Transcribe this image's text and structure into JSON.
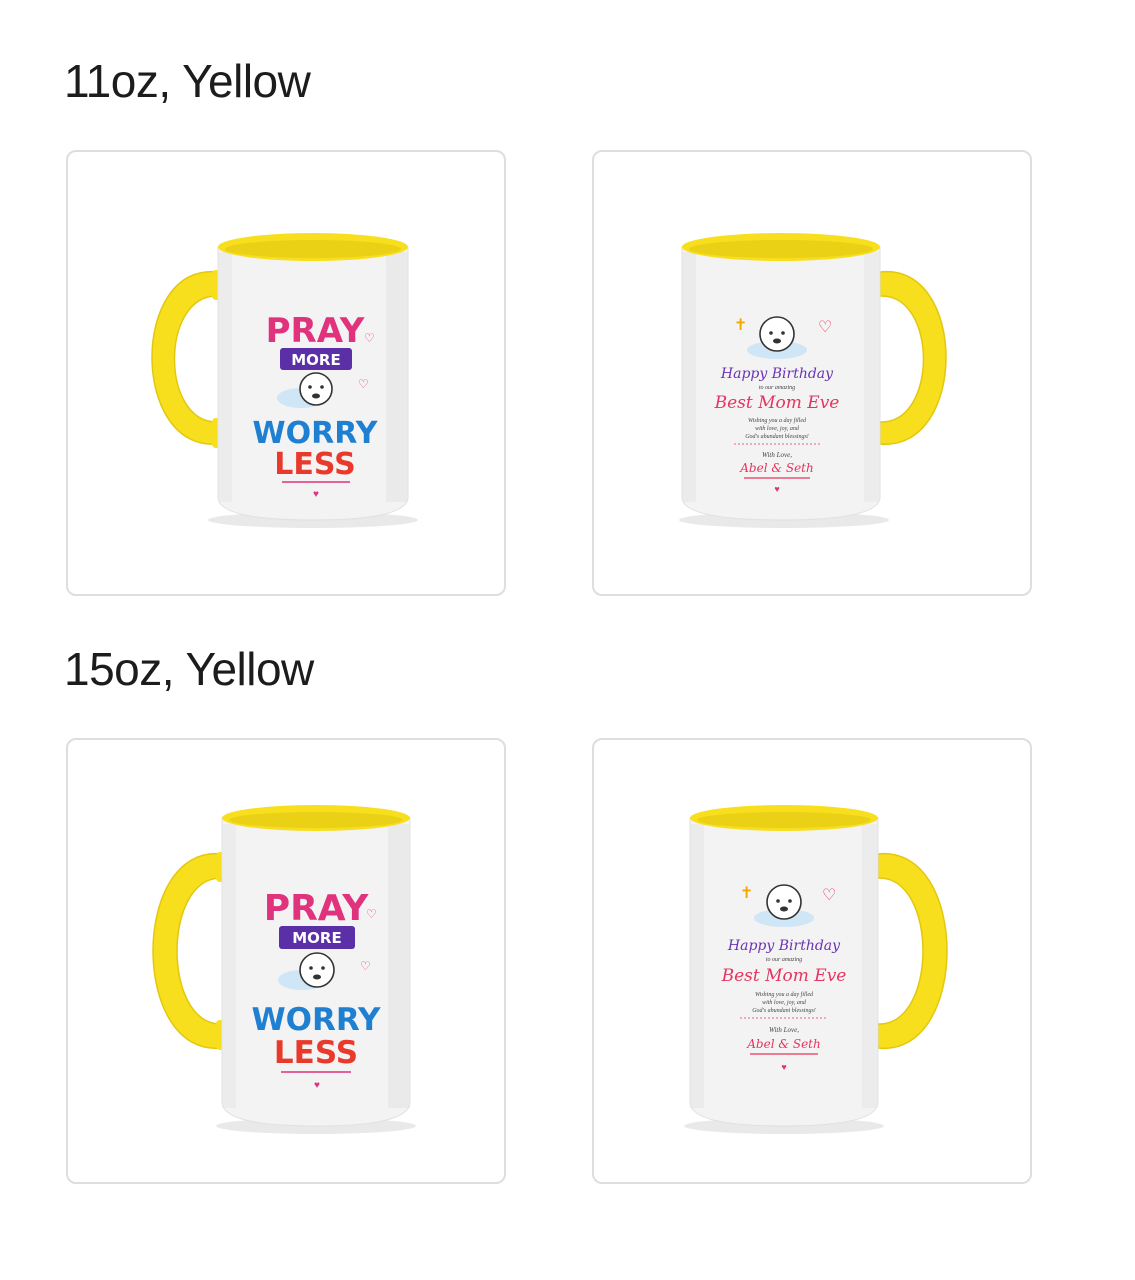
{
  "variants": [
    {
      "title": "11oz, Yellow",
      "front": {
        "line1": "PRAY",
        "line2": "MORE",
        "line3": "WORRY",
        "line4": "LESS"
      },
      "back": {
        "heading": "Happy Birthday",
        "subheading": "to our amazing",
        "name": "Best Mom Eve",
        "message_1": "Wishing you a day filled",
        "message_2": "with love, joy, and",
        "message_3": "God's abundant blessings!",
        "closing": "With Love,",
        "signature": "Abel & Seth"
      }
    },
    {
      "title": "15oz, Yellow",
      "front": {
        "line1": "PRAY",
        "line2": "MORE",
        "line3": "WORRY",
        "line4": "LESS"
      },
      "back": {
        "heading": "Happy Birthday",
        "subheading": "to our amazing",
        "name": "Best Mom Eve",
        "message_1": "Wishing you a day filled",
        "message_2": "with love, joy, and",
        "message_3": "God's abundant blessings!",
        "closing": "With Love,",
        "signature": "Abel & Seth"
      }
    }
  ],
  "colors": {
    "mug_accent": "#f7df1e",
    "mug_body": "#f3f3f3",
    "card_border": "#dedede",
    "pray": "#e0327d",
    "more_banner": "#5b2fa6",
    "worry": "#1f7fd1",
    "less": "#e8392b",
    "birthday_heading": "#6a34b0",
    "birthday_name": "#e5345f"
  }
}
